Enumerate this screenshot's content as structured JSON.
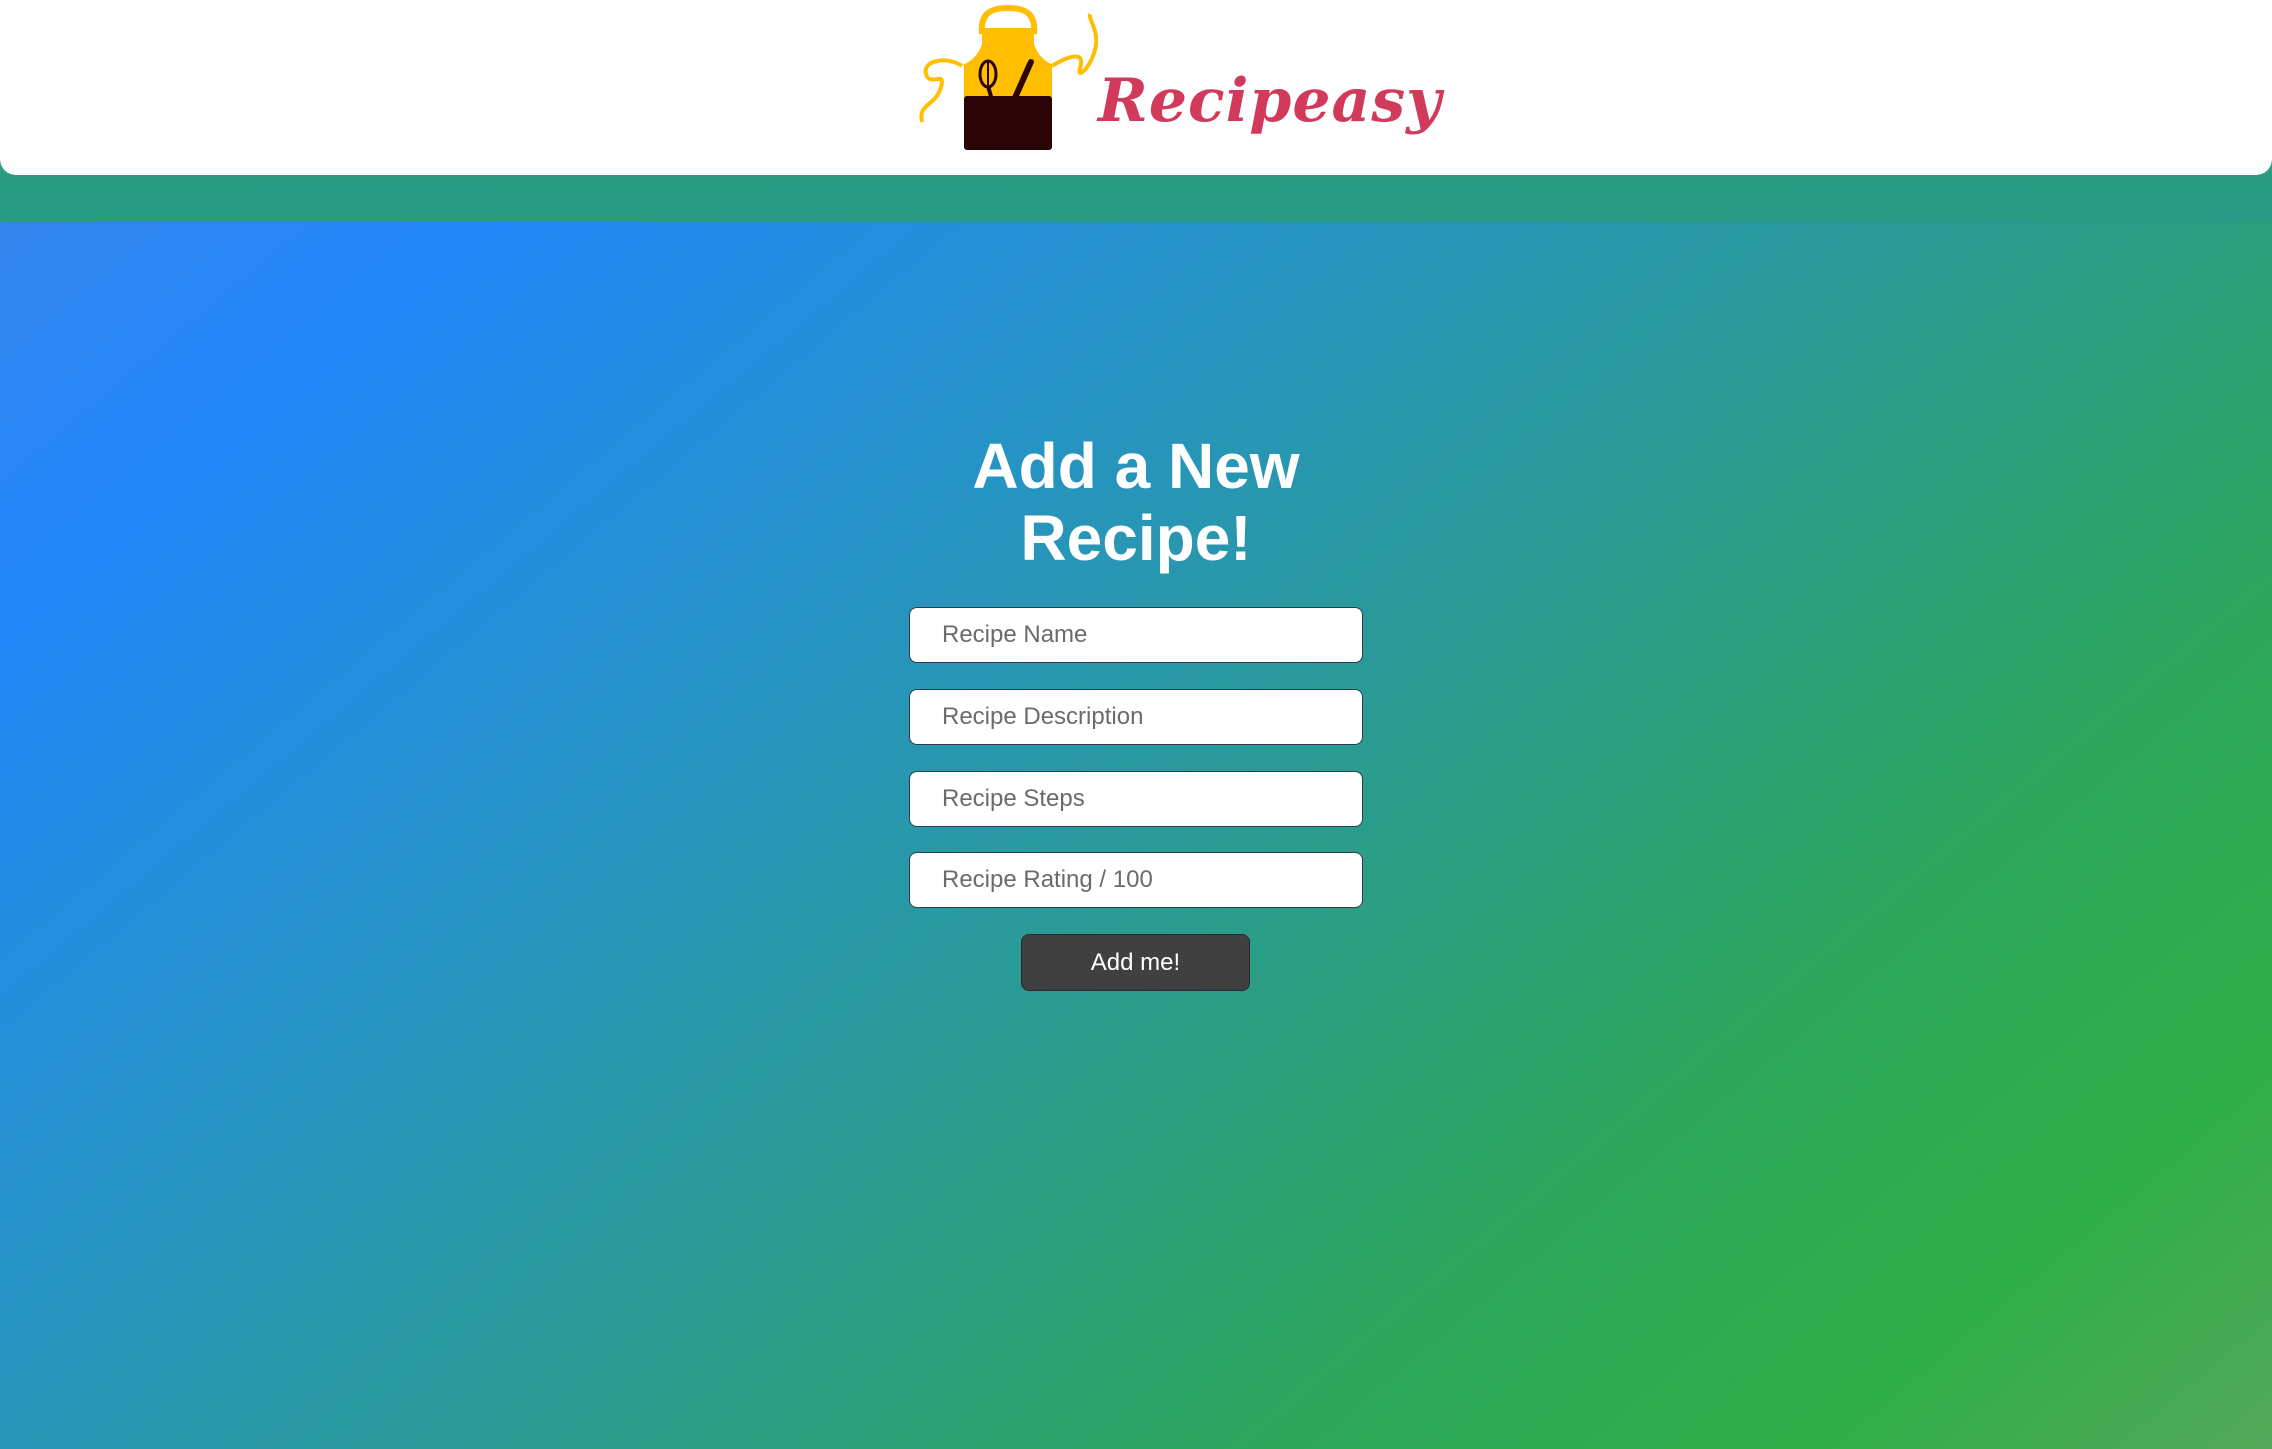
{
  "brand": {
    "name": "Recipeasy",
    "logo_icon": "apron-icon",
    "name_color": "#d13a5a",
    "apron_color": "#ffbf00",
    "pocket_color": "#2b0406"
  },
  "form": {
    "title": "Add a New Recipe!",
    "fields": [
      {
        "placeholder": "Recipe Name",
        "value": ""
      },
      {
        "placeholder": "Recipe Description",
        "value": ""
      },
      {
        "placeholder": "Recipe Steps",
        "value": ""
      },
      {
        "placeholder": "Recipe Rating / 100",
        "value": ""
      }
    ],
    "submit_label": "Add me!"
  },
  "colors": {
    "background_gradient": [
      "#2387fb",
      "#2a9c86",
      "#2eaf48"
    ],
    "header_bg": "#ffffff",
    "button_bg": "#404040"
  }
}
